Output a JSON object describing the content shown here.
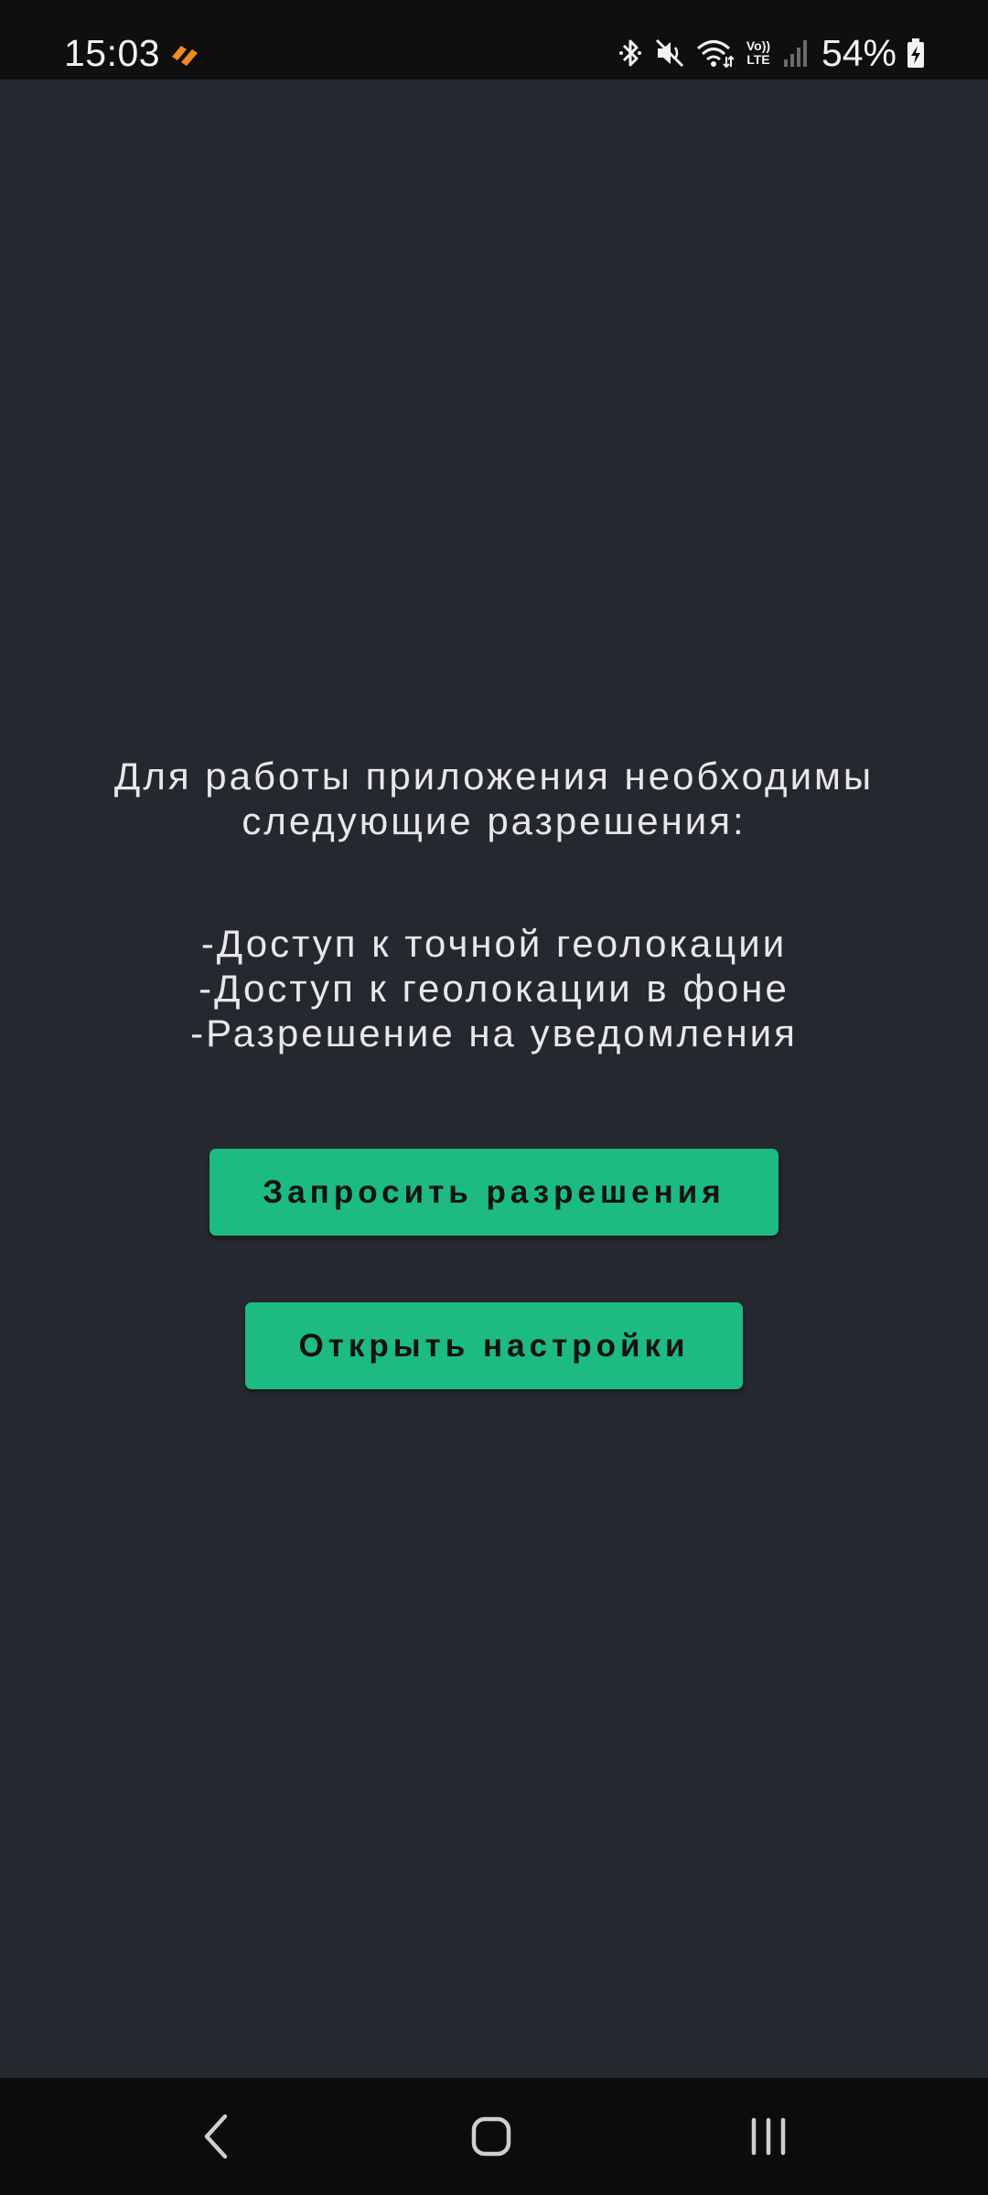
{
  "status_bar": {
    "time": "15:03",
    "app_icon": "orange-app-icon",
    "icons": [
      "bluetooth-icon",
      "mute-icon",
      "wifi-icon",
      "volte-lte-icon",
      "signal-icon",
      "battery-charging-icon"
    ],
    "volte_label_top": "Vo))",
    "volte_label_bottom": "LTE",
    "battery_percent": "54%"
  },
  "main": {
    "intro_line1": "Для работы приложения необходимы",
    "intro_line2": "следующие разрешения:",
    "permissions": [
      "-Доступ к точной геолокации",
      "-Доступ к геолокации в фоне",
      "-Разрешение на уведомления"
    ],
    "request_button_label": "Запросить разрешения",
    "settings_button_label": "Открыть настройки"
  },
  "nav_bar": {
    "icons": [
      "back-icon",
      "home-icon",
      "recents-icon"
    ]
  },
  "colors": {
    "background": "#25282f",
    "status_bar": "#0f0f10",
    "nav_bar": "#0c0c0d",
    "accent": "#1dba82",
    "text": "#e8e8ea",
    "app_icon": "#f08a24"
  }
}
